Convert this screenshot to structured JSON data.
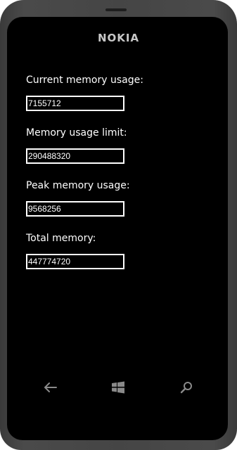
{
  "device": {
    "brand": "NOKIA"
  },
  "fields": [
    {
      "label": "Current memory usage:",
      "value": "7155712"
    },
    {
      "label": "Memory usage limit:",
      "value": "290488320"
    },
    {
      "label": "Peak memory usage:",
      "value": "9568256"
    },
    {
      "label": "Total memory:",
      "value": "447774720"
    }
  ],
  "nav": {
    "icons": [
      "back-arrow-icon",
      "windows-logo-icon",
      "search-icon"
    ]
  },
  "colors": {
    "screen": "#000000",
    "text": "#ffffff",
    "bezel": "#454545",
    "nav_icon": "#8a8a8a"
  }
}
